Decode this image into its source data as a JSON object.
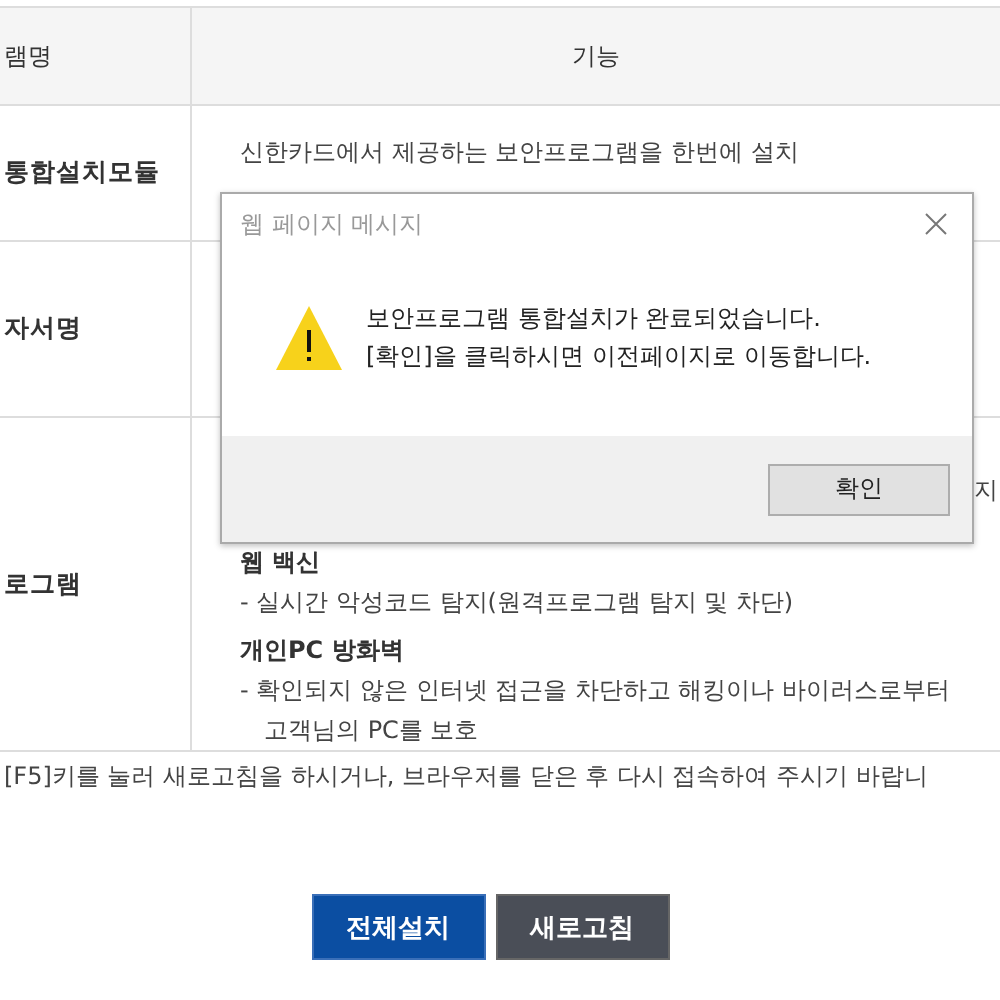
{
  "table": {
    "columns": [
      "램명",
      "기능"
    ],
    "rows": [
      {
        "name": "통합설치모듈",
        "lines": [
          {
            "kind": "text",
            "text": "신한카드에서 제공하는 보안프로그램을 한번에 설치"
          }
        ]
      },
      {
        "name": "자서명",
        "lines": []
      },
      {
        "name": "로그램",
        "fragment": "지",
        "lines": [
          {
            "kind": "heading",
            "text": "웹 백신"
          },
          {
            "kind": "text",
            "text": "- 실시간 악성코드 탐지(원격프로그램 탐지 및 차단)"
          },
          {
            "kind": "heading",
            "text": "개인PC 방화벽"
          },
          {
            "kind": "text",
            "text": "- 확인되지 않은 인터넷 접근을 차단하고 해킹이나 바이러스로부터"
          },
          {
            "kind": "indent",
            "text": "고객님의 PC를 보호"
          }
        ]
      }
    ]
  },
  "notice": "[F5]키를 눌러 새로고침을 하시거나, 브라우저를 닫은 후 다시 접속하여 주시기 바랍니",
  "buttons": [
    {
      "label": "전체설치",
      "kind": "primary"
    },
    {
      "label": "새로고침",
      "kind": "secondary"
    }
  ],
  "dialog": {
    "title": "웹 페이지 메시지",
    "messages": [
      "보안프로그램 통합설치가 완료되었습니다.",
      "[확인]을 클릭하시면 이전페이지로 이동합니다."
    ],
    "button": "확인"
  }
}
